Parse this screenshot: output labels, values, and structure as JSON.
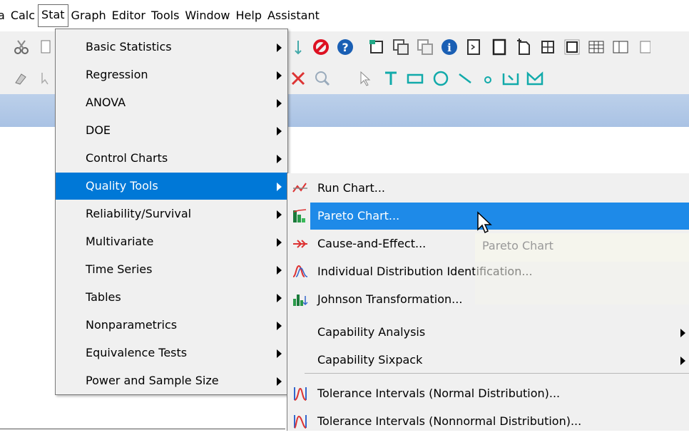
{
  "menubar": {
    "items": [
      "a",
      "Calc",
      "Stat",
      "Graph",
      "Editor",
      "Tools",
      "Window",
      "Help",
      "Assistant"
    ],
    "active": "Stat"
  },
  "stat_menu": {
    "items": [
      {
        "label": "Basic Statistics",
        "submenu": true
      },
      {
        "label": "Regression",
        "submenu": true
      },
      {
        "label": "ANOVA",
        "submenu": true
      },
      {
        "label": "DOE",
        "submenu": true
      },
      {
        "label": "Control Charts",
        "submenu": true
      },
      {
        "label": "Quality Tools",
        "submenu": true,
        "highlighted": true
      },
      {
        "label": "Reliability/Survival",
        "submenu": true
      },
      {
        "label": "Multivariate",
        "submenu": true
      },
      {
        "label": "Time Series",
        "submenu": true
      },
      {
        "label": "Tables",
        "submenu": true
      },
      {
        "label": "Nonparametrics",
        "submenu": true
      },
      {
        "label": "Equivalence Tests",
        "submenu": true
      },
      {
        "label": "Power and Sample Size",
        "submenu": true
      }
    ]
  },
  "quality_tools_menu": {
    "items": [
      {
        "label": "Run Chart...",
        "icon": "run-chart-icon"
      },
      {
        "label": "Pareto Chart...",
        "icon": "pareto-chart-icon",
        "highlighted": true
      },
      {
        "label": "Cause-and-Effect...",
        "icon": "cause-effect-icon"
      },
      {
        "label": "Individual Distribution Identification...",
        "icon": "distribution-id-icon"
      },
      {
        "label": "Johnson Transformation...",
        "icon": "johnson-icon"
      },
      {
        "label": "Capability Analysis",
        "submenu": true
      },
      {
        "label": "Capability Sixpack",
        "submenu": true
      },
      {
        "label": "Tolerance Intervals (Normal Distribution)...",
        "icon": "tolerance-normal-icon"
      },
      {
        "label": "Tolerance Intervals (Nonnormal Distribution)...",
        "icon": "tolerance-nonnormal-icon"
      }
    ]
  },
  "tooltip": {
    "text": "Pareto Chart"
  },
  "colors": {
    "highlight": "#0078d7",
    "highlight_sub": "#1e8ae8",
    "menu_bg": "#f0f0f0",
    "band": "#b4cae8"
  }
}
